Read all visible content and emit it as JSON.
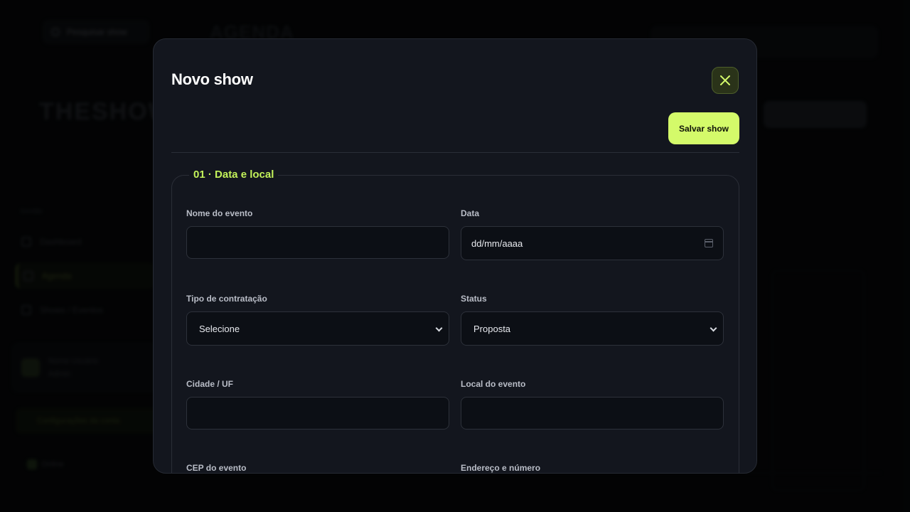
{
  "background": {
    "search_placeholder": "Pesquisar show",
    "page_title": "AGENDA",
    "logo": "THESHOW",
    "sidebar_section": "Gestão",
    "nav": [
      "Dashboard",
      "Agenda",
      "Shows / Eventos"
    ],
    "user": {
      "name": "Nome Usuário",
      "role": "Admin"
    },
    "cta": "Configurações da conta",
    "online": "Online"
  },
  "modal": {
    "title": "Novo show",
    "close_icon": "close-icon",
    "save_label": "Salvar show",
    "section_title": "01 · Data e local",
    "fields": {
      "event_name": {
        "label": "Nome do evento",
        "value": ""
      },
      "date": {
        "label": "Data",
        "value": "dd/mm/aaaa"
      },
      "contract_type": {
        "label": "Tipo de contratação",
        "value": "Selecione"
      },
      "status": {
        "label": "Status",
        "value": "Proposta"
      },
      "city": {
        "label": "Cidade / UF",
        "value": ""
      },
      "venue": {
        "label": "Local do evento",
        "value": ""
      },
      "zip": {
        "label": "CEP do evento"
      },
      "address": {
        "label": "Endereço e número"
      }
    }
  },
  "colors": {
    "accent": "#d4fa6a",
    "section_title": "#c3f25a",
    "modal_bg": "#13161e",
    "input_bg": "#0c0f15"
  }
}
